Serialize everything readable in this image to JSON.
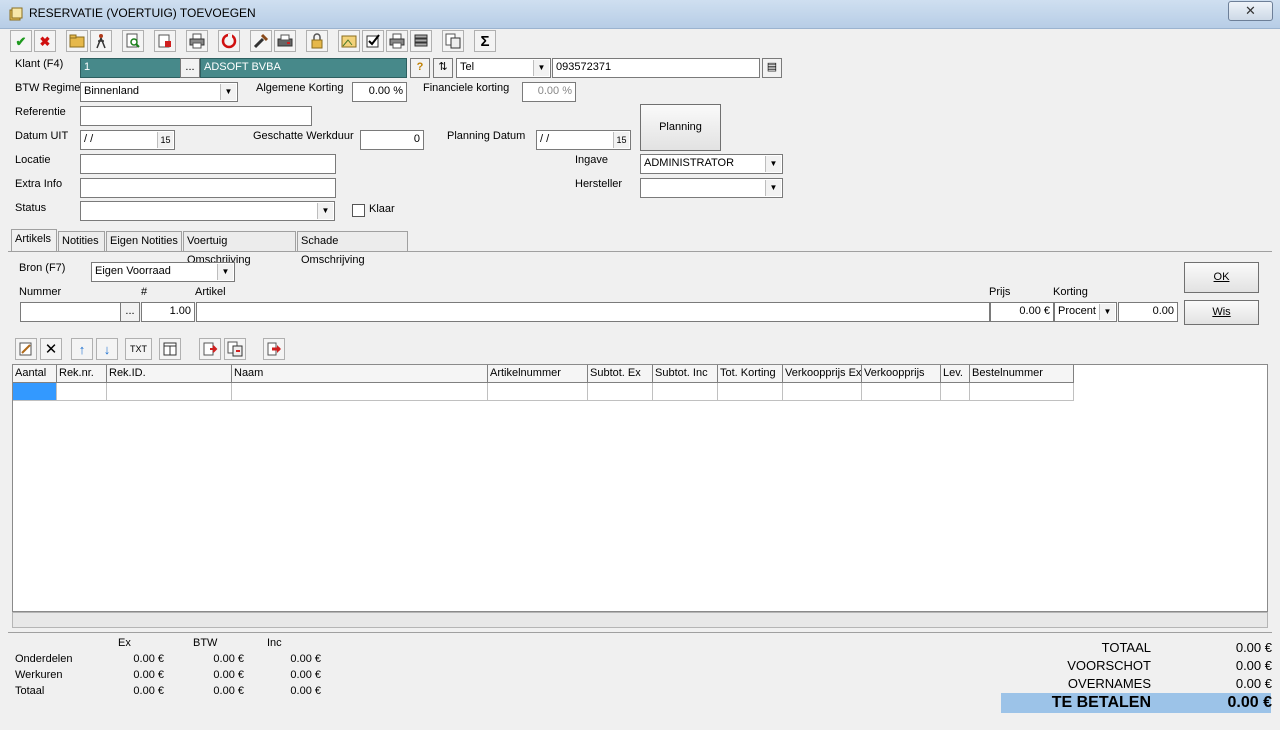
{
  "window": {
    "title": "RESERVATIE (VOERTUIG) TOEVOEGEN",
    "close_label": "✕"
  },
  "toolbar": {
    "icons": [
      "check-icon",
      "cancel-icon",
      "folder-icon",
      "walk-icon",
      "search-doc-icon",
      "new-doc-icon",
      "print-icon",
      "refresh-icon",
      "tools-icon",
      "printer-icon",
      "lock-icon",
      "image-icon",
      "checkbox-icon",
      "print2-icon",
      "stack-icon",
      "copy-icon",
      "sum-icon"
    ],
    "sum_label": "Σ"
  },
  "form": {
    "klant_label": "Klant (F4)",
    "klant_code": "1",
    "klant_name": "ADSOFT BVBA",
    "contact_type": "Tel",
    "contact_value": "093572371",
    "btw_label": "BTW Regime",
    "btw_value": "Binnenland",
    "algemene_korting_label": "Algemene Korting",
    "algemene_korting_value": "0.00 %",
    "financiele_korting_label": "Financiele korting",
    "financiele_korting_value": "0.00 %",
    "referentie_label": "Referentie",
    "referentie_value": "",
    "datum_uit_label": "Datum UIT",
    "datum_uit_value": " / /",
    "werkduur_label": "Geschatte Werkduur",
    "werkduur_value": "0",
    "planning_datum_label": "Planning Datum",
    "planning_datum_value": " / /",
    "planning_button": "Planning",
    "locatie_label": "Locatie",
    "ingave_label": "Ingave",
    "ingave_value": "ADMINISTRATOR",
    "extra_info_label": "Extra Info",
    "hersteller_label": "Hersteller",
    "hersteller_value": "",
    "status_label": "Status",
    "status_value": "",
    "klaar_label": "Klaar",
    "calendar_glyph": "15"
  },
  "tabs": [
    "Artikels",
    "Notities",
    "Eigen Notities",
    "Voertuig Omschrijving",
    "Schade Omschrijving"
  ],
  "artikel": {
    "bron_label": "Bron (F7)",
    "bron_value": "Eigen Voorraad",
    "nummer_label": "Nummer",
    "hash_label": "#",
    "artikel_label": "Artikel",
    "prijs_label": "Prijs",
    "korting_label": "Korting",
    "qty_value": "1.00",
    "prijs_value": "0.00 €",
    "korting_type": "Procent",
    "korting_value": "0.00",
    "ok_button": "OK",
    "wis_button": "Wis",
    "ellipsis": "..."
  },
  "grid_toolbar": {
    "txt_label": "TXT"
  },
  "grid": {
    "columns": [
      "Aantal",
      "Rek.nr.",
      "Rek.ID.",
      "Naam",
      "Artikelnummer",
      "Subtot. Ex",
      "Subtot. Inc",
      "Tot. Korting",
      "Verkoopprijs Ex",
      "Verkoopprijs",
      "Lev.",
      "Bestelnummer"
    ]
  },
  "summary": {
    "headers": {
      "ex": "Ex",
      "btw": "BTW",
      "inc": "Inc"
    },
    "rows": [
      {
        "label": "Onderdelen",
        "ex": "0.00 €",
        "btw": "0.00 €",
        "inc": "0.00 €"
      },
      {
        "label": "Werkuren",
        "ex": "0.00 €",
        "btw": "0.00 €",
        "inc": "0.00 €"
      },
      {
        "label": "Totaal",
        "ex": "0.00 €",
        "btw": "0.00 €",
        "inc": "0.00 €"
      }
    ]
  },
  "totals": {
    "totaal_label": "TOTAAL",
    "totaal_value": "0.00 €",
    "voorschot_label": "VOORSCHOT",
    "voorschot_value": "0.00 €",
    "overnames_label": "OVERNAMES",
    "overnames_value": "0.00 €",
    "te_betalen_label": "TE BETALEN",
    "te_betalen_value": "0.00 €"
  }
}
